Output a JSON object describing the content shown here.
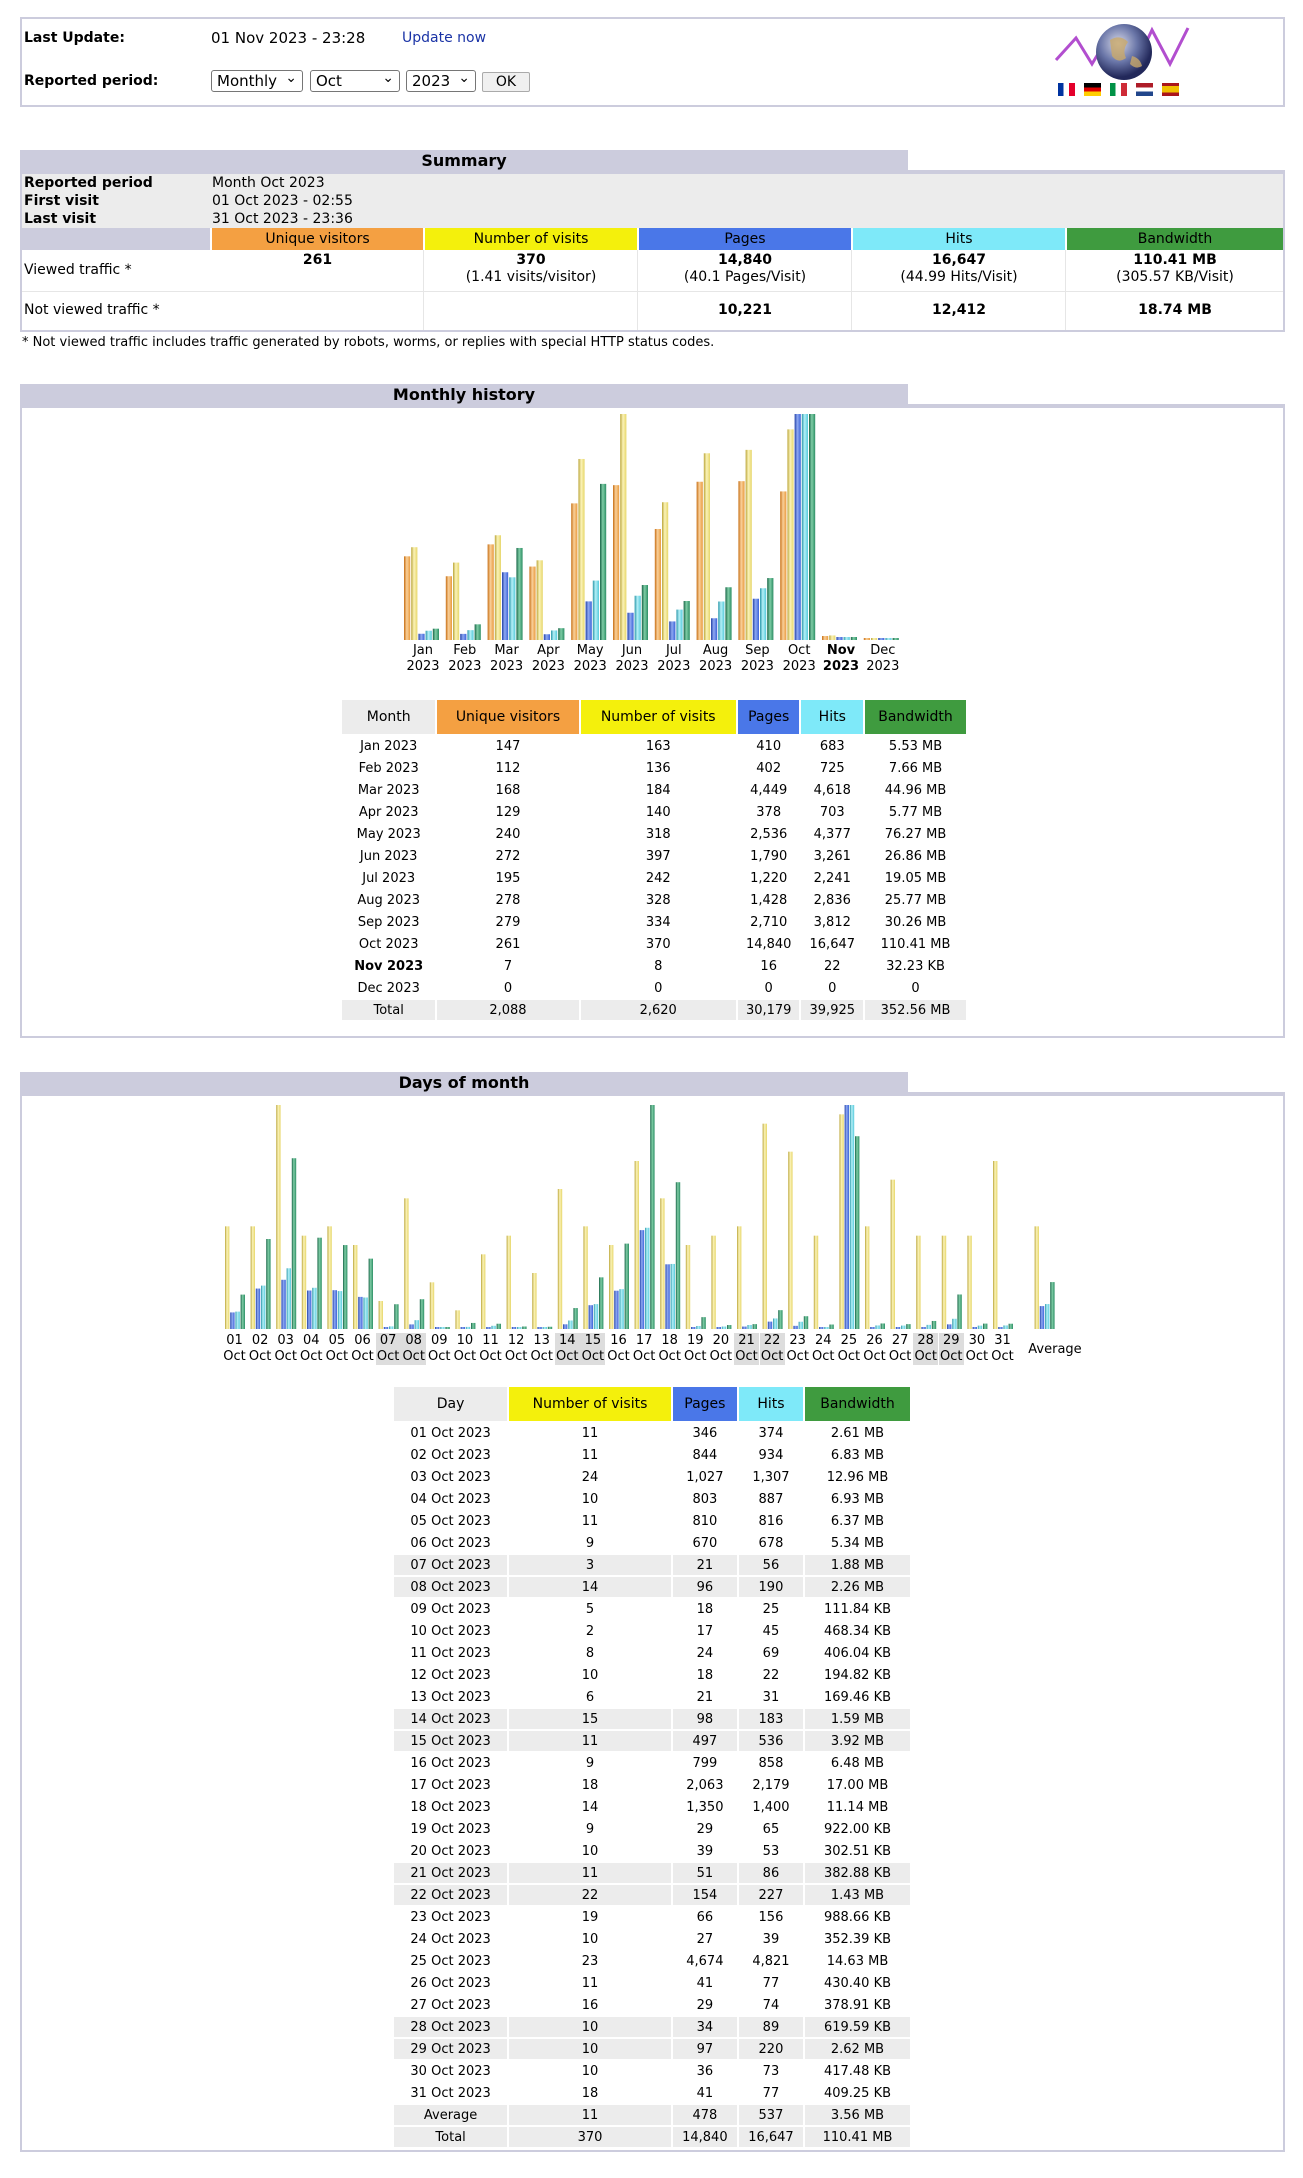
{
  "header": {
    "last_update_label": "Last Update:",
    "last_update_value": "01 Nov 2023 - 23:28",
    "update_now": "Update now",
    "reported_period_label": "Reported period:",
    "period_type": "Monthly",
    "month": "Oct",
    "year": "2023",
    "ok": "OK"
  },
  "summary": {
    "title": "Summary",
    "reported_period_label": "Reported period",
    "reported_period_value": "Month Oct 2023",
    "first_visit_label": "First visit",
    "first_visit_value": "01 Oct 2023 - 02:55",
    "last_visit_label": "Last visit",
    "last_visit_value": "31 Oct 2023 - 23:36",
    "columns": [
      "Unique visitors",
      "Number of visits",
      "Pages",
      "Hits",
      "Bandwidth"
    ],
    "viewed_label": "Viewed traffic *",
    "viewed": [
      "261",
      "370",
      "14,840",
      "16,647",
      "110.41 MB"
    ],
    "viewed_sub": [
      "",
      "(1.41 visits/visitor)",
      "(40.1 Pages/Visit)",
      "(44.99 Hits/Visit)",
      "(305.57 KB/Visit)"
    ],
    "not_viewed_label": "Not viewed traffic *",
    "not_viewed": [
      "",
      "",
      "10,221",
      "12,412",
      "18.74 MB"
    ],
    "footnote": "* Not viewed traffic includes traffic generated by robots, worms, or replies with special HTTP status codes."
  },
  "monthly": {
    "title": "Monthly history",
    "headers": [
      "Month",
      "Unique visitors",
      "Number of visits",
      "Pages",
      "Hits",
      "Bandwidth"
    ],
    "rows": [
      [
        "Jan 2023",
        "147",
        "163",
        "410",
        "683",
        "5.53 MB"
      ],
      [
        "Feb 2023",
        "112",
        "136",
        "402",
        "725",
        "7.66 MB"
      ],
      [
        "Mar 2023",
        "168",
        "184",
        "4,449",
        "4,618",
        "44.96 MB"
      ],
      [
        "Apr 2023",
        "129",
        "140",
        "378",
        "703",
        "5.77 MB"
      ],
      [
        "May 2023",
        "240",
        "318",
        "2,536",
        "4,377",
        "76.27 MB"
      ],
      [
        "Jun 2023",
        "272",
        "397",
        "1,790",
        "3,261",
        "26.86 MB"
      ],
      [
        "Jul 2023",
        "195",
        "242",
        "1,220",
        "2,241",
        "19.05 MB"
      ],
      [
        "Aug 2023",
        "278",
        "328",
        "1,428",
        "2,836",
        "25.77 MB"
      ],
      [
        "Sep 2023",
        "279",
        "334",
        "2,710",
        "3,812",
        "30.26 MB"
      ],
      [
        "Oct 2023",
        "261",
        "370",
        "14,840",
        "16,647",
        "110.41 MB"
      ],
      [
        "Nov 2023",
        "7",
        "8",
        "16",
        "22",
        "32.23 KB"
      ],
      [
        "Dec 2023",
        "0",
        "0",
        "0",
        "0",
        "0"
      ]
    ],
    "total": [
      "Total",
      "2,088",
      "2,620",
      "30,179",
      "39,925",
      "352.56 MB"
    ]
  },
  "daily": {
    "title": "Days of month",
    "headers": [
      "Day",
      "Number of visits",
      "Pages",
      "Hits",
      "Bandwidth"
    ],
    "rows": [
      [
        "01 Oct 2023",
        "11",
        "346",
        "374",
        "2.61 MB"
      ],
      [
        "02 Oct 2023",
        "11",
        "844",
        "934",
        "6.83 MB"
      ],
      [
        "03 Oct 2023",
        "24",
        "1,027",
        "1,307",
        "12.96 MB"
      ],
      [
        "04 Oct 2023",
        "10",
        "803",
        "887",
        "6.93 MB"
      ],
      [
        "05 Oct 2023",
        "11",
        "810",
        "816",
        "6.37 MB"
      ],
      [
        "06 Oct 2023",
        "9",
        "670",
        "678",
        "5.34 MB"
      ],
      [
        "07 Oct 2023",
        "3",
        "21",
        "56",
        "1.88 MB"
      ],
      [
        "08 Oct 2023",
        "14",
        "96",
        "190",
        "2.26 MB"
      ],
      [
        "09 Oct 2023",
        "5",
        "18",
        "25",
        "111.84 KB"
      ],
      [
        "10 Oct 2023",
        "2",
        "17",
        "45",
        "468.34 KB"
      ],
      [
        "11 Oct 2023",
        "8",
        "24",
        "69",
        "406.04 KB"
      ],
      [
        "12 Oct 2023",
        "10",
        "18",
        "22",
        "194.82 KB"
      ],
      [
        "13 Oct 2023",
        "6",
        "21",
        "31",
        "169.46 KB"
      ],
      [
        "14 Oct 2023",
        "15",
        "98",
        "183",
        "1.59 MB"
      ],
      [
        "15 Oct 2023",
        "11",
        "497",
        "536",
        "3.92 MB"
      ],
      [
        "16 Oct 2023",
        "9",
        "799",
        "858",
        "6.48 MB"
      ],
      [
        "17 Oct 2023",
        "18",
        "2,063",
        "2,179",
        "17.00 MB"
      ],
      [
        "18 Oct 2023",
        "14",
        "1,350",
        "1,400",
        "11.14 MB"
      ],
      [
        "19 Oct 2023",
        "9",
        "29",
        "65",
        "922.00 KB"
      ],
      [
        "20 Oct 2023",
        "10",
        "39",
        "53",
        "302.51 KB"
      ],
      [
        "21 Oct 2023",
        "11",
        "51",
        "86",
        "382.88 KB"
      ],
      [
        "22 Oct 2023",
        "22",
        "154",
        "227",
        "1.43 MB"
      ],
      [
        "23 Oct 2023",
        "19",
        "66",
        "156",
        "988.66 KB"
      ],
      [
        "24 Oct 2023",
        "10",
        "27",
        "39",
        "352.39 KB"
      ],
      [
        "25 Oct 2023",
        "23",
        "4,674",
        "4,821",
        "14.63 MB"
      ],
      [
        "26 Oct 2023",
        "11",
        "41",
        "77",
        "430.40 KB"
      ],
      [
        "27 Oct 2023",
        "16",
        "29",
        "74",
        "378.91 KB"
      ],
      [
        "28 Oct 2023",
        "10",
        "34",
        "89",
        "619.59 KB"
      ],
      [
        "29 Oct 2023",
        "10",
        "97",
        "220",
        "2.62 MB"
      ],
      [
        "30 Oct 2023",
        "10",
        "36",
        "73",
        "417.48 KB"
      ],
      [
        "31 Oct 2023",
        "18",
        "41",
        "77",
        "409.25 KB"
      ]
    ],
    "average": [
      "Average",
      "11",
      "478",
      "537",
      "3.56 MB"
    ],
    "total": [
      "Total",
      "370",
      "14,840",
      "16,647",
      "110.41 MB"
    ],
    "average_label": "Average",
    "day_suffix": "Oct"
  },
  "chart_data": [
    {
      "type": "bar",
      "title": "Monthly history",
      "categories": [
        "Jan 2023",
        "Feb 2023",
        "Mar 2023",
        "Apr 2023",
        "May 2023",
        "Jun 2023",
        "Jul 2023",
        "Aug 2023",
        "Sep 2023",
        "Oct 2023",
        "Nov 2023",
        "Dec 2023"
      ],
      "series": [
        {
          "name": "Unique visitors",
          "values": [
            147,
            112,
            168,
            129,
            240,
            272,
            195,
            278,
            279,
            261,
            7,
            0
          ]
        },
        {
          "name": "Number of visits",
          "values": [
            163,
            136,
            184,
            140,
            318,
            397,
            242,
            328,
            334,
            370,
            8,
            0
          ]
        },
        {
          "name": "Pages",
          "values": [
            410,
            402,
            4449,
            378,
            2536,
            1790,
            1220,
            1428,
            2710,
            14840,
            16,
            0
          ]
        },
        {
          "name": "Hits",
          "values": [
            683,
            725,
            4618,
            703,
            4377,
            3261,
            2241,
            2836,
            3812,
            16647,
            22,
            0
          ]
        },
        {
          "name": "Bandwidth (MB)",
          "values": [
            5.53,
            7.66,
            44.96,
            5.77,
            76.27,
            26.86,
            19.05,
            25.77,
            30.26,
            110.41,
            0.03,
            0
          ]
        }
      ]
    },
    {
      "type": "bar",
      "title": "Days of month",
      "categories": [
        "01",
        "02",
        "03",
        "04",
        "05",
        "06",
        "07",
        "08",
        "09",
        "10",
        "11",
        "12",
        "13",
        "14",
        "15",
        "16",
        "17",
        "18",
        "19",
        "20",
        "21",
        "22",
        "23",
        "24",
        "25",
        "26",
        "27",
        "28",
        "29",
        "30",
        "31",
        "Average"
      ],
      "series": [
        {
          "name": "Number of visits",
          "values": [
            11,
            11,
            24,
            10,
            11,
            9,
            3,
            14,
            5,
            2,
            8,
            10,
            6,
            15,
            11,
            9,
            18,
            14,
            9,
            10,
            11,
            22,
            19,
            10,
            23,
            11,
            16,
            10,
            10,
            10,
            18,
            11
          ]
        },
        {
          "name": "Pages",
          "values": [
            346,
            844,
            1027,
            803,
            810,
            670,
            21,
            96,
            18,
            17,
            24,
            18,
            21,
            98,
            497,
            799,
            2063,
            1350,
            29,
            39,
            51,
            154,
            66,
            27,
            4674,
            41,
            29,
            34,
            97,
            36,
            41,
            478
          ]
        },
        {
          "name": "Hits",
          "values": [
            374,
            934,
            1307,
            887,
            816,
            678,
            56,
            190,
            25,
            45,
            69,
            22,
            31,
            183,
            536,
            858,
            2179,
            1400,
            65,
            53,
            86,
            227,
            156,
            39,
            4821,
            77,
            74,
            89,
            220,
            73,
            77,
            537
          ]
        },
        {
          "name": "Bandwidth (MB)",
          "values": [
            2.61,
            6.83,
            12.96,
            6.93,
            6.37,
            5.34,
            1.88,
            2.26,
            0.11,
            0.46,
            0.4,
            0.19,
            0.17,
            1.59,
            3.92,
            6.48,
            17.0,
            11.14,
            0.9,
            0.3,
            0.37,
            1.43,
            0.97,
            0.34,
            14.63,
            0.42,
            0.37,
            0.61,
            2.62,
            0.41,
            0.4,
            3.56
          ]
        }
      ]
    }
  ]
}
